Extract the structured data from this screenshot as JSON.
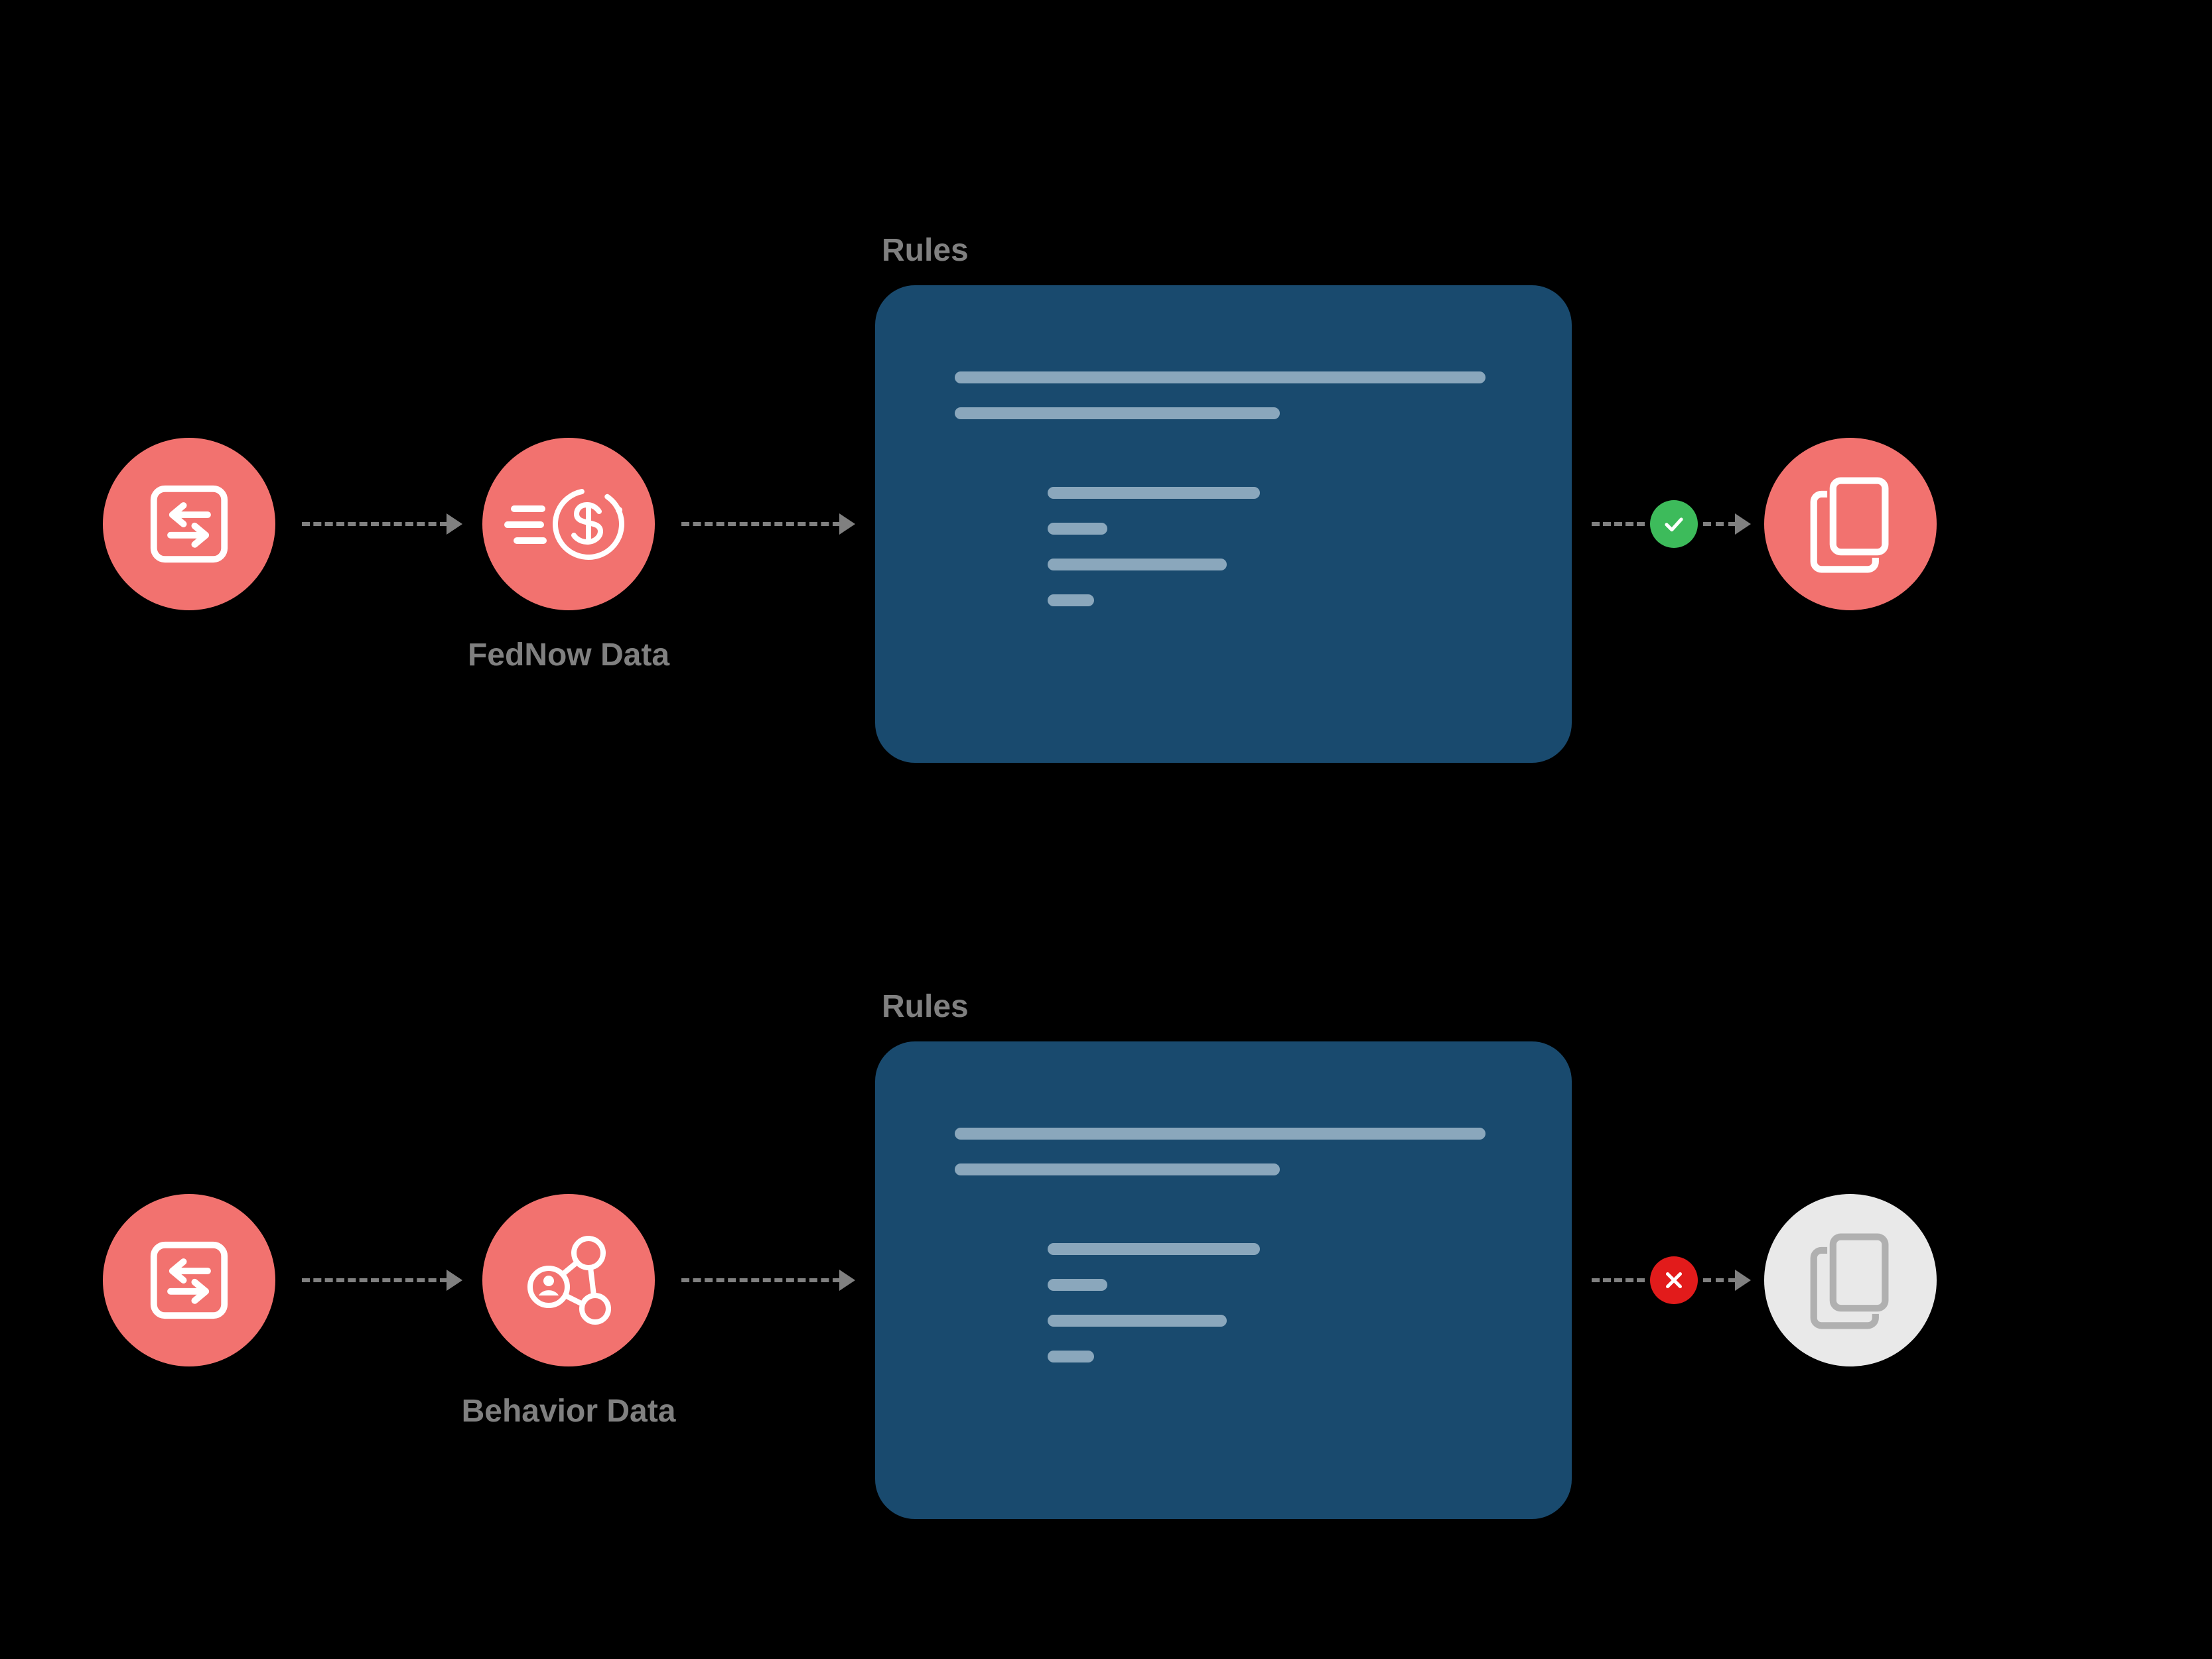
{
  "colors": {
    "bg": "#000000",
    "coral": "#F2726F",
    "light_node": "#E9E9E9",
    "rules_box": "#194A6E",
    "rule_line": "#8AA7BC",
    "arrow": "#808080",
    "label": "#808080",
    "badge_green": "#3DBB5B",
    "badge_red": "#E21B1B",
    "icon_stroke_white": "#FFFFFF",
    "icon_stroke_gray": "#B0B0B0"
  },
  "flows": [
    {
      "rules_title": "Rules",
      "data_label": "FedNow Data",
      "data_icon": "fast-dollar-icon",
      "outcome": "pass",
      "output_variant": "coral"
    },
    {
      "rules_title": "Rules",
      "data_label": "Behavior Data",
      "data_icon": "network-user-icon",
      "outcome": "fail",
      "output_variant": "light"
    }
  ],
  "icons": {
    "start": "transfer-arrows-icon",
    "output": "documents-stack-icon",
    "pass": "check-icon",
    "fail": "x-icon"
  }
}
